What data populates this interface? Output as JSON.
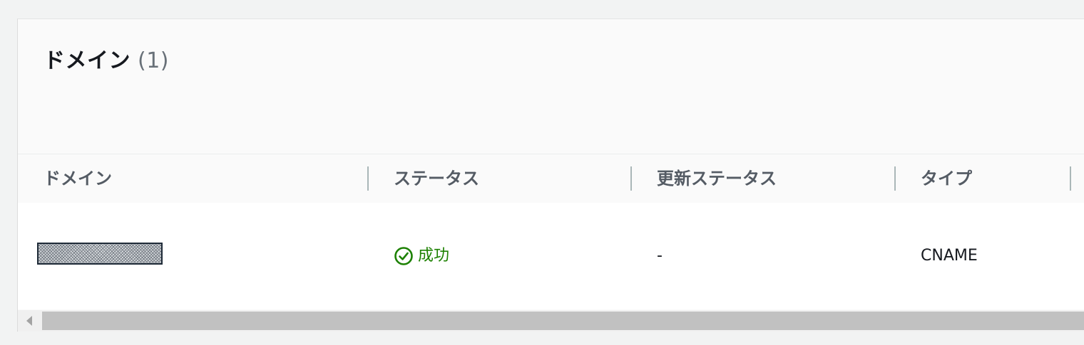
{
  "panel": {
    "title": "ドメイン",
    "count": "(1)"
  },
  "table": {
    "headers": [
      "ドメイン",
      "ステータス",
      "更新ステータス",
      "タイプ"
    ],
    "rows": [
      {
        "domain": "",
        "status": "成功",
        "status_icon": "check-circle-icon",
        "update_status": "-",
        "type": "CNAME"
      }
    ]
  },
  "colors": {
    "success": "#1d8102",
    "header_text": "#545b64",
    "divider": "#aab7b8"
  }
}
